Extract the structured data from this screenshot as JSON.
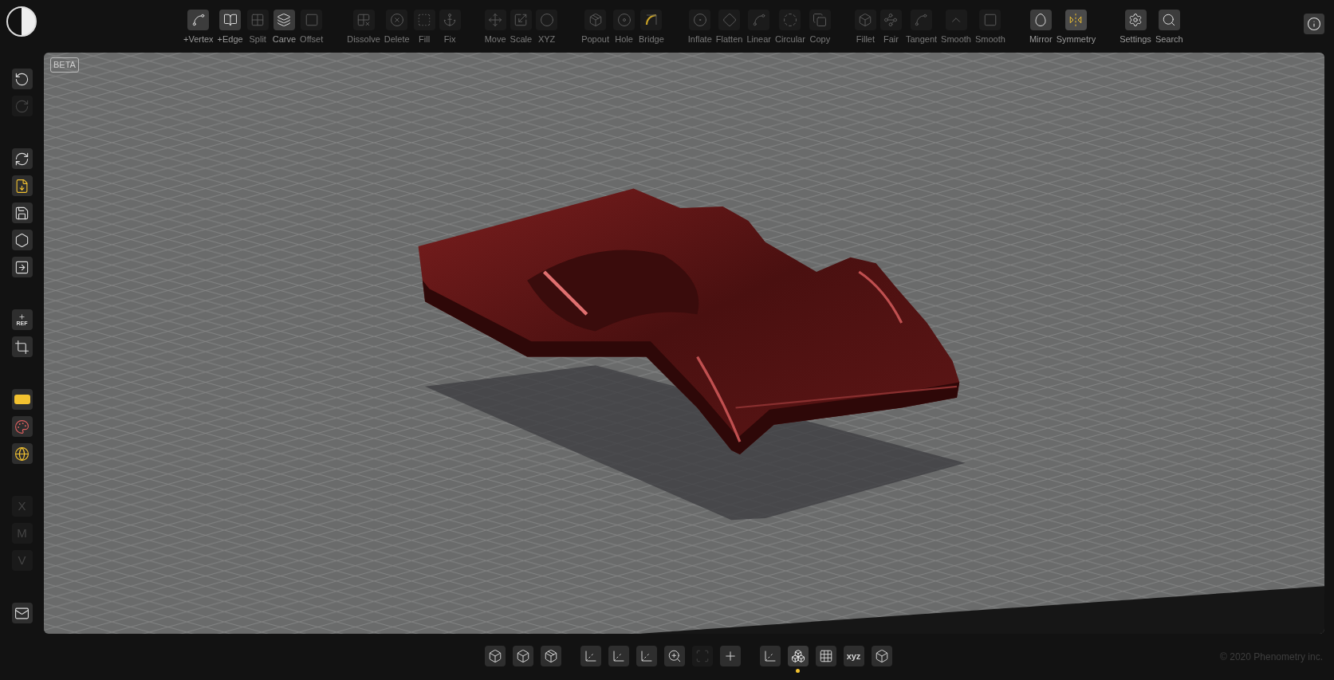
{
  "toolbar": {
    "groups": [
      {
        "tools": [
          {
            "label": "+Vertex",
            "enabled": true
          },
          {
            "label": "+Edge",
            "enabled": true
          },
          {
            "label": "Split",
            "enabled": false
          },
          {
            "label": "Carve",
            "enabled": true
          },
          {
            "label": "Offset",
            "enabled": false
          }
        ]
      },
      {
        "tools": [
          {
            "label": "Dissolve",
            "enabled": false
          },
          {
            "label": "Delete",
            "enabled": false
          },
          {
            "label": "Fill",
            "enabled": false
          },
          {
            "label": "Fix",
            "enabled": false
          }
        ]
      },
      {
        "tools": [
          {
            "label": "Move",
            "enabled": false
          },
          {
            "label": "Scale",
            "enabled": false
          },
          {
            "label": "XYZ",
            "enabled": false
          }
        ]
      },
      {
        "tools": [
          {
            "label": "Popout",
            "enabled": false
          },
          {
            "label": "Hole",
            "enabled": false
          },
          {
            "label": "Bridge",
            "enabled": false
          }
        ]
      },
      {
        "tools": [
          {
            "label": "Inflate",
            "enabled": false
          },
          {
            "label": "Flatten",
            "enabled": false
          },
          {
            "label": "Linear",
            "enabled": false
          },
          {
            "label": "Circular",
            "enabled": false
          },
          {
            "label": "Copy",
            "enabled": false
          }
        ]
      },
      {
        "tools": [
          {
            "label": "Fillet",
            "enabled": false
          },
          {
            "label": "Fair",
            "enabled": false
          },
          {
            "label": "Tangent",
            "enabled": false
          },
          {
            "label": "Smooth",
            "enabled": false
          },
          {
            "label": "Smooth",
            "enabled": false
          }
        ]
      },
      {
        "tools": [
          {
            "label": "Mirror",
            "enabled": true
          },
          {
            "label": "Symmetry",
            "enabled": true
          }
        ]
      },
      {
        "tools": [
          {
            "label": "Settings",
            "enabled": true
          },
          {
            "label": "Search",
            "enabled": true
          }
        ]
      }
    ]
  },
  "sidebar": {
    "groups": [
      {
        "items": [
          {
            "kind": "icon",
            "enabled": true
          },
          {
            "kind": "icon",
            "enabled": false
          }
        ]
      },
      {
        "items": [
          {
            "kind": "icon",
            "enabled": true
          },
          {
            "kind": "icon",
            "enabled": true
          },
          {
            "kind": "icon",
            "enabled": true
          },
          {
            "kind": "icon",
            "enabled": true
          },
          {
            "kind": "icon",
            "enabled": true
          }
        ]
      },
      {
        "items": [
          {
            "kind": "text",
            "label": "REF",
            "enabled": true
          },
          {
            "kind": "icon",
            "enabled": true
          }
        ]
      },
      {
        "items": [
          {
            "kind": "icon",
            "enabled": true
          },
          {
            "kind": "icon",
            "enabled": true
          },
          {
            "kind": "icon",
            "enabled": true
          }
        ]
      },
      {
        "items": [
          {
            "kind": "text",
            "label": "X",
            "enabled": false
          },
          {
            "kind": "text",
            "label": "M",
            "enabled": false
          },
          {
            "kind": "text",
            "label": "V",
            "enabled": false
          }
        ]
      },
      {
        "items": [
          {
            "kind": "icon",
            "enabled": true
          }
        ]
      }
    ]
  },
  "viewport": {
    "badge": "BETA"
  },
  "bottom_toolbar": {
    "groups": [
      {
        "items": [
          {
            "enabled": true,
            "selected": false
          },
          {
            "enabled": true,
            "selected": false
          },
          {
            "enabled": true,
            "selected": false
          }
        ]
      },
      {
        "items": [
          {
            "enabled": true,
            "selected": false
          },
          {
            "enabled": true,
            "selected": false
          },
          {
            "enabled": true,
            "selected": false
          },
          {
            "enabled": true,
            "selected": false
          },
          {
            "enabled": false,
            "selected": false
          },
          {
            "enabled": true,
            "selected": false
          }
        ]
      },
      {
        "items": [
          {
            "enabled": true,
            "selected": false
          },
          {
            "enabled": true,
            "selected": true
          },
          {
            "enabled": true,
            "selected": false
          },
          {
            "enabled": true,
            "selected": false,
            "label": "xyz"
          },
          {
            "enabled": true,
            "selected": false
          }
        ]
      }
    ]
  },
  "copyright": "© 2020 Phenometry inc."
}
